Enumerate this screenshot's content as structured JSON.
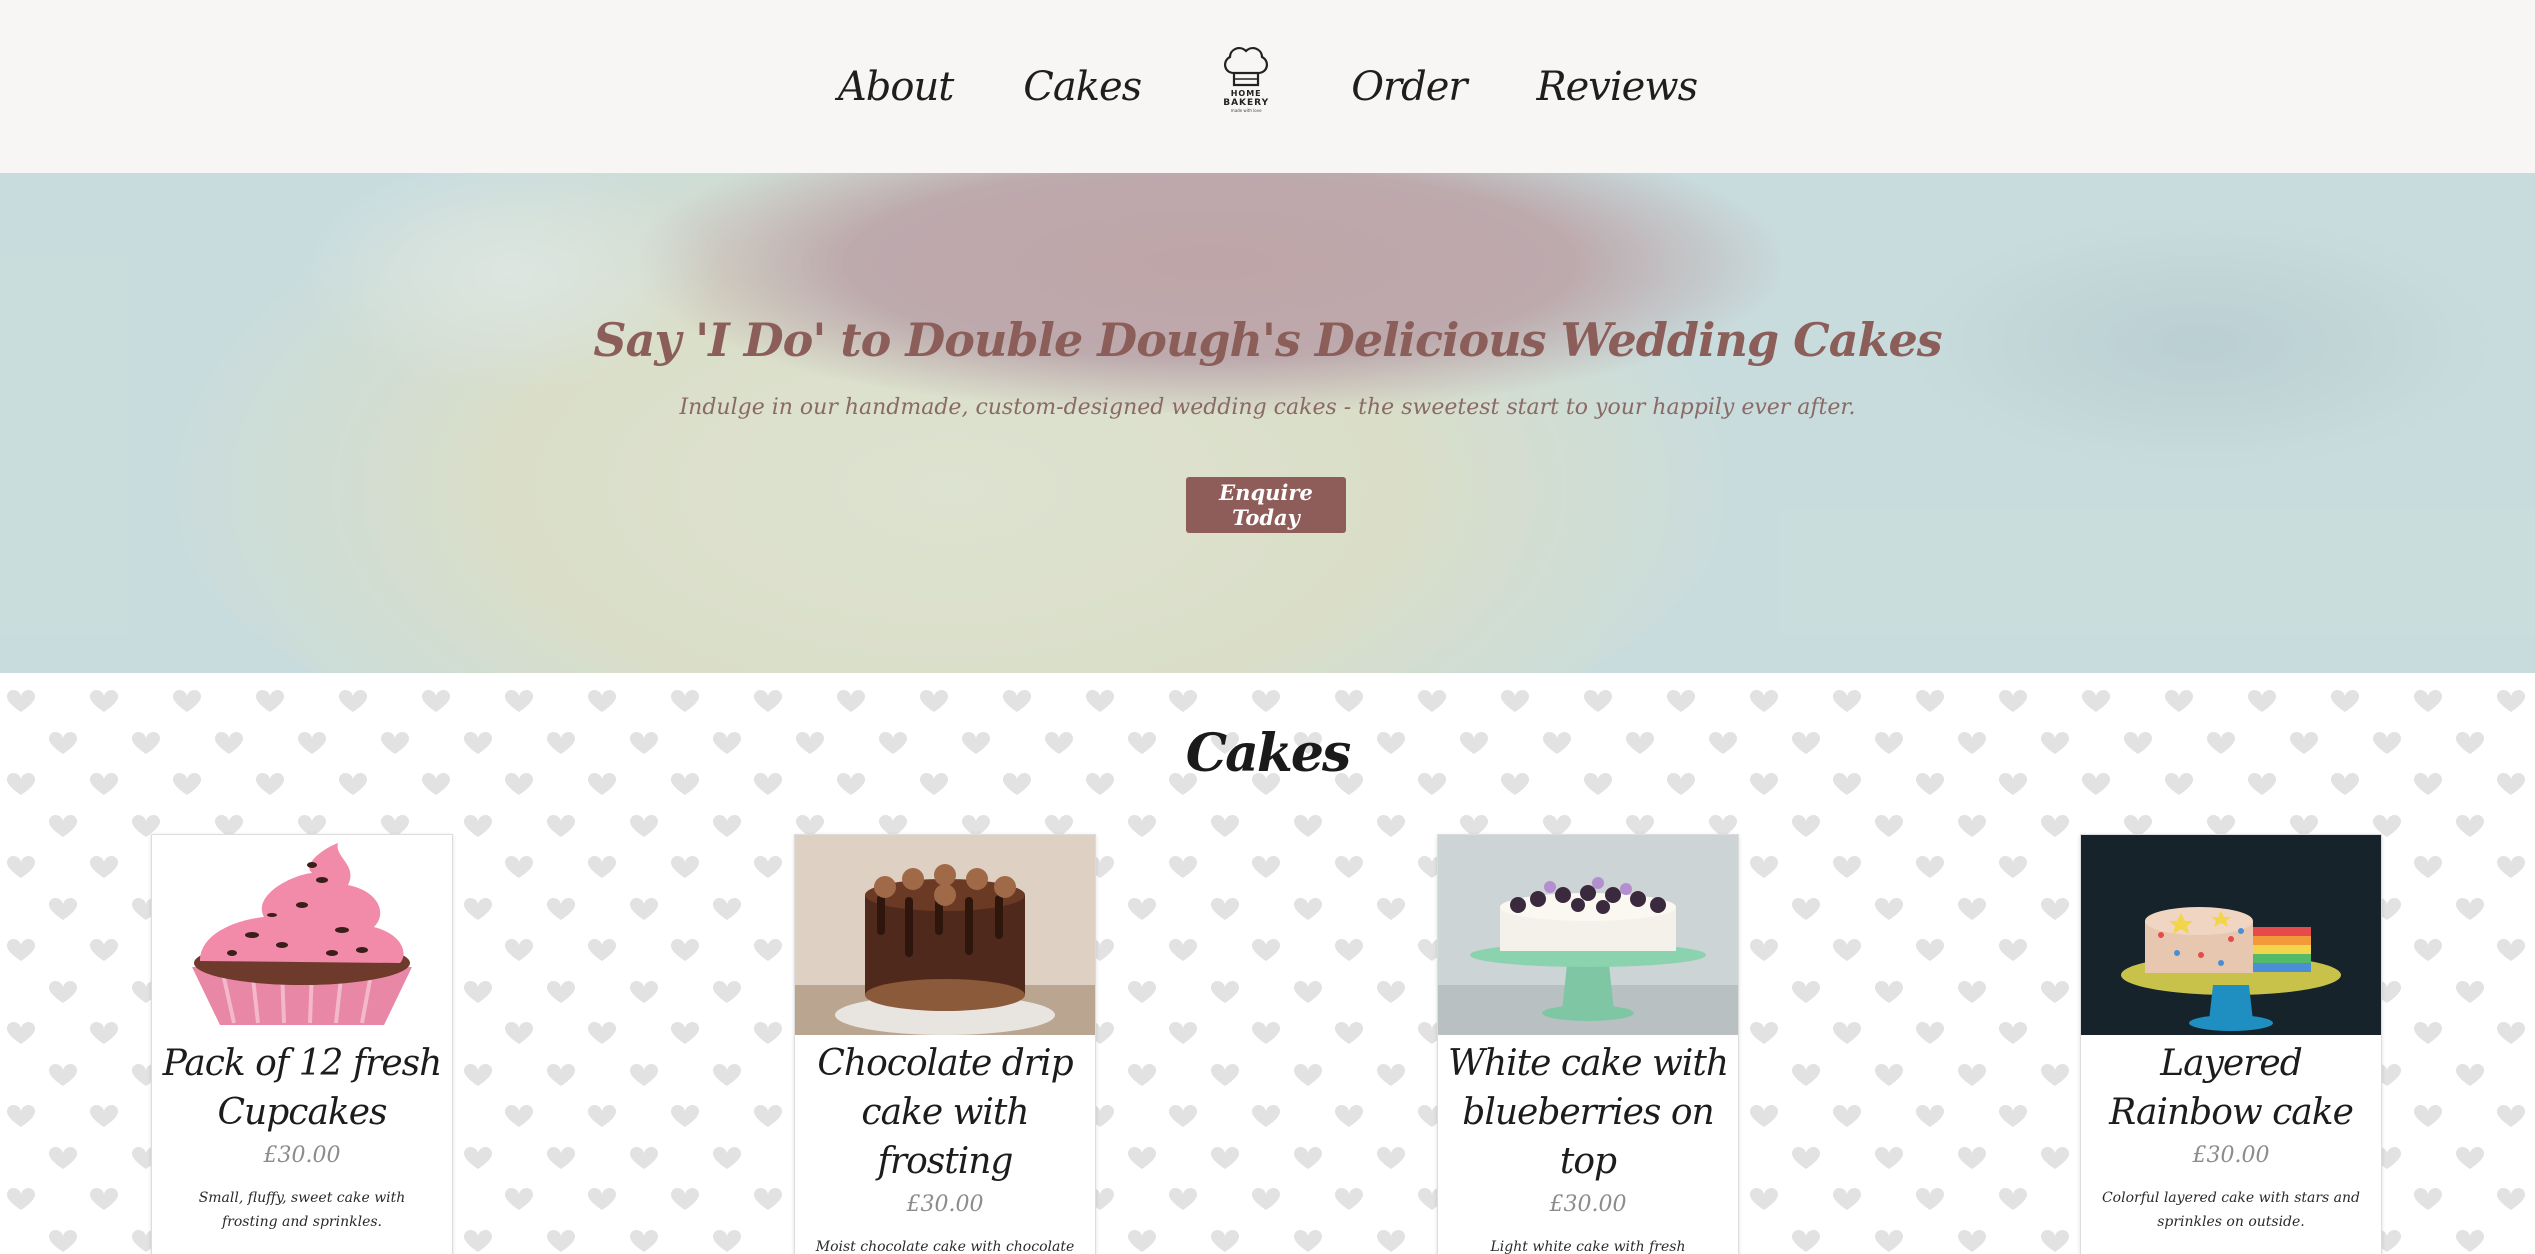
{
  "nav": {
    "items": [
      {
        "label": "About"
      },
      {
        "label": "Cakes"
      },
      {
        "label": "Order"
      },
      {
        "label": "Reviews"
      }
    ],
    "logo": {
      "line1": "HOME",
      "line2": "BAKERY",
      "tagline": "made with love"
    }
  },
  "hero": {
    "title": "Say 'I Do' to Double Dough's Delicious Wedding Cakes",
    "subtitle": "Indulge in our handmade, custom-designed wedding cakes - the sweetest start to your happily ever after.",
    "button": "Enquire Today"
  },
  "cakes": {
    "title": "Cakes",
    "items": [
      {
        "name": "Pack of 12 fresh Cupcakes",
        "price": "£30.00",
        "description": "Small, fluffy, sweet cake with frosting and sprinkles."
      },
      {
        "name": "Chocolate drip cake with frosting",
        "price": "£30.00",
        "description": "Moist chocolate cake with chocolate drip and decorations."
      },
      {
        "name": "White cake with blueberries on top",
        "price": "£30.00",
        "description": "Light white cake with fresh blueberries on top and flower decorations."
      },
      {
        "name": "Layered Rainbow cake",
        "price": "£30.00",
        "description": "Colorful layered cake with stars and sprinkles on outside."
      }
    ]
  },
  "colors": {
    "header_bg": "#f7f6f4",
    "accent": "#8e5d59",
    "hero_text": "#8b5e5a"
  }
}
